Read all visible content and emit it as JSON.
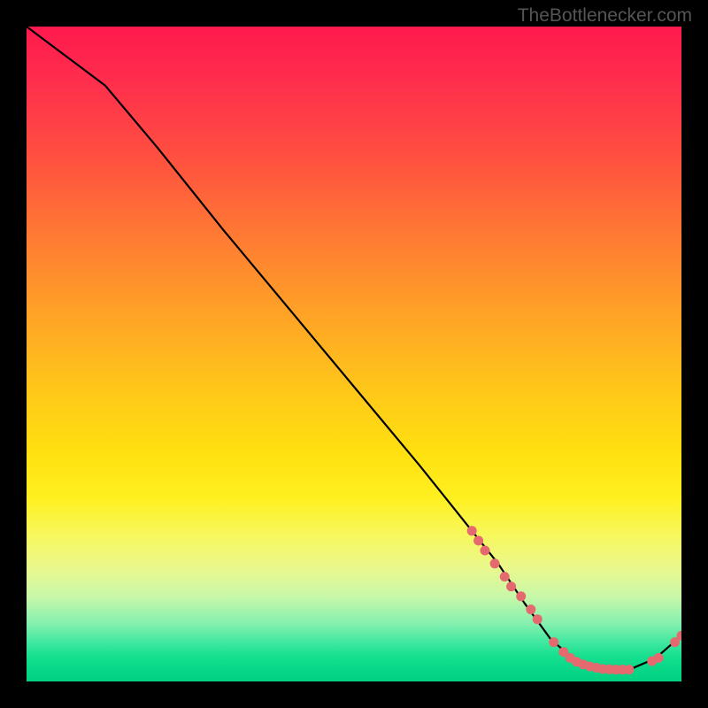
{
  "watermark": "TheBottlenecker.com",
  "chart_data": {
    "type": "line",
    "title": "",
    "xlabel": "",
    "ylabel": "",
    "xlim": [
      0,
      100
    ],
    "ylim": [
      0,
      100
    ],
    "series": [
      {
        "name": "curve",
        "x": [
          0,
          4,
          8,
          12,
          20,
          30,
          40,
          50,
          60,
          68,
          72,
          76,
          80,
          84,
          88,
          92,
          96,
          100
        ],
        "y": [
          100,
          97,
          94,
          91,
          81.5,
          69,
          57,
          45,
          33,
          23,
          18,
          12,
          6.5,
          3,
          1.8,
          1.8,
          3.5,
          7
        ]
      }
    ],
    "markers": {
      "name": "points",
      "color": "#e46a6f",
      "x": [
        68,
        69,
        70,
        71.5,
        73,
        74,
        75.5,
        77,
        78,
        80.5,
        82,
        83,
        84,
        85,
        86,
        87,
        88,
        89,
        90,
        91,
        92,
        95.5,
        96.5,
        99,
        100
      ],
      "y": [
        23,
        21.5,
        20,
        18,
        16,
        14.5,
        13,
        11,
        9.5,
        6,
        4.5,
        3.6,
        3,
        2.6,
        2.3,
        2.1,
        1.9,
        1.85,
        1.8,
        1.8,
        1.8,
        3.1,
        3.6,
        6,
        7
      ]
    },
    "gradient_stops": [
      {
        "pos": 0.0,
        "color": "#ff1a4d"
      },
      {
        "pos": 0.5,
        "color": "#ffc61a"
      },
      {
        "pos": 0.78,
        "color": "#f6f860"
      },
      {
        "pos": 1.0,
        "color": "#00d080"
      }
    ]
  }
}
